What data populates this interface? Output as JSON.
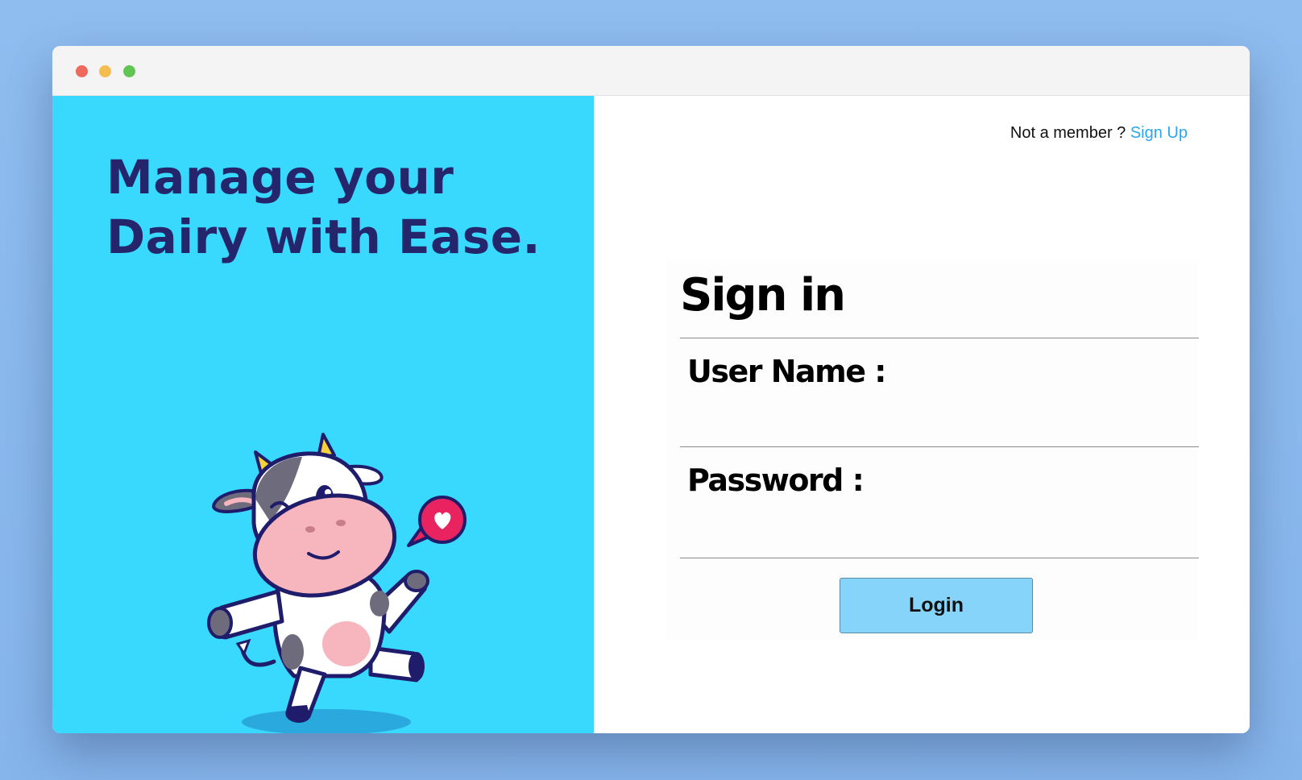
{
  "window": {
    "controls": [
      "close",
      "minimize",
      "maximize"
    ]
  },
  "hero": {
    "headline": "Manage your Dairy with Ease.",
    "illustration": "cartoon-cow-with-heart-icon",
    "background_color": "#39d8fd",
    "headline_color": "#24256b"
  },
  "auth": {
    "prompt": "Not a member ?",
    "signup_label": "Sign Up",
    "link_color": "#29a7f0"
  },
  "form": {
    "title": "Sign in",
    "username_label": "User Name :",
    "username_value": "",
    "password_label": "Password :",
    "password_value": "",
    "login_label": "Login",
    "button_color": "#87d4fb"
  }
}
